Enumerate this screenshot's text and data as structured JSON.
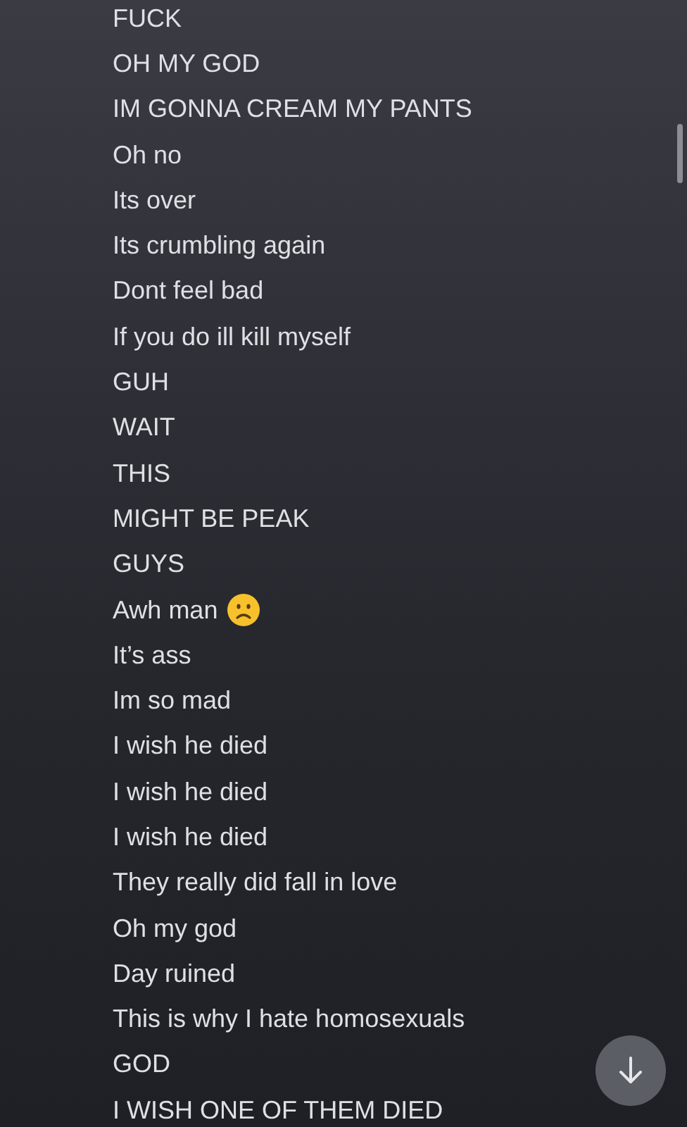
{
  "messages": [
    {
      "kind": "text",
      "text": "FUCK"
    },
    {
      "kind": "text",
      "text": "OH MY GOD"
    },
    {
      "kind": "text",
      "text": "IM GONNA CREAM MY PANTS"
    },
    {
      "kind": "text",
      "text": "Oh no"
    },
    {
      "kind": "text",
      "text": "Its over"
    },
    {
      "kind": "text",
      "text": "Its crumbling again"
    },
    {
      "kind": "text",
      "text": "Dont feel bad"
    },
    {
      "kind": "text",
      "text": "If you do ill kill myself"
    },
    {
      "kind": "text",
      "text": "GUH"
    },
    {
      "kind": "text",
      "text": "WAIT"
    },
    {
      "kind": "text",
      "text": "THIS"
    },
    {
      "kind": "text",
      "text": "MIGHT BE PEAK"
    },
    {
      "kind": "text",
      "text": "GUYS"
    },
    {
      "kind": "emoji",
      "text": "Awh man"
    },
    {
      "kind": "text",
      "text": "It’s ass"
    },
    {
      "kind": "text",
      "text": "Im so mad"
    },
    {
      "kind": "text",
      "text": "I wish he died"
    },
    {
      "kind": "text",
      "text": "I wish he died"
    },
    {
      "kind": "text",
      "text": "I wish he died"
    },
    {
      "kind": "text",
      "text": "They really did fall in love"
    },
    {
      "kind": "text",
      "text": "Oh my god"
    },
    {
      "kind": "text",
      "text": "Day ruined"
    },
    {
      "kind": "text",
      "text": "This is why I hate homosexuals"
    },
    {
      "kind": "text",
      "text": "GOD"
    },
    {
      "kind": "text",
      "text": "I WISH ONE OF THEM DIED"
    }
  ]
}
